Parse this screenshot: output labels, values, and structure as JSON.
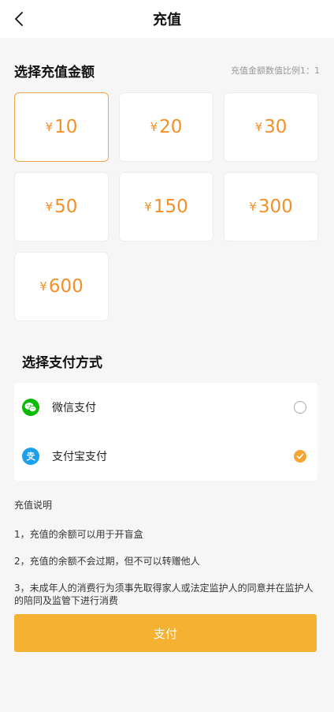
{
  "header": {
    "title": "充值"
  },
  "amount_section": {
    "title": "选择充值金额",
    "ratio_note": "充值金额数值比例1：1",
    "currency_symbol": "¥",
    "options": [
      "10",
      "20",
      "30",
      "50",
      "150",
      "300",
      "600"
    ],
    "selected": "10"
  },
  "payment_section": {
    "title": "选择支付方式",
    "methods": [
      {
        "label": "微信支付",
        "icon": "wechat-icon",
        "selected": false
      },
      {
        "label": "支付宝支付",
        "icon": "alipay-icon",
        "selected": true
      }
    ]
  },
  "notes": {
    "title": "充值说明",
    "items": [
      "1，充值的余额可以用于开盲盒",
      "2，充值的余额不会过期，但不可以转赠他人",
      "3，未成年人的消费行为须事先取得家人或法定监护人的同意并在监护人的陪同及监管下进行消费"
    ]
  },
  "pay_button": {
    "label": "支付"
  },
  "colors": {
    "accent": "#f2902a",
    "button": "#f4b132",
    "wechat": "#09bb07",
    "alipay": "#1c9fec"
  }
}
